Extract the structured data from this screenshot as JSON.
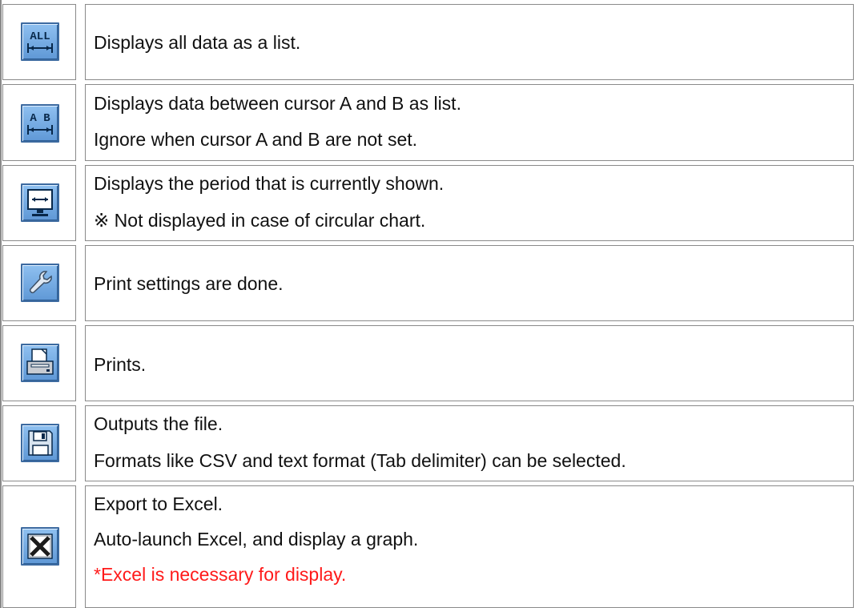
{
  "rows": [
    {
      "icon": "all-range-icon",
      "lines": [
        "Displays all data as a list."
      ]
    },
    {
      "icon": "ab-range-icon",
      "lines": [
        "Displays data between cursor A and B as list.",
        "Ignore when cursor A and B are not set."
      ]
    },
    {
      "icon": "monitor-period-icon",
      "lines": [
        "Displays the period that is currently shown.",
        "※ Not displayed in case of circular chart."
      ]
    },
    {
      "icon": "wrench-icon",
      "lines": [
        "Print settings are done."
      ]
    },
    {
      "icon": "printer-icon",
      "lines": [
        "Prints."
      ]
    },
    {
      "icon": "floppy-disk-icon",
      "lines": [
        "Outputs the file.",
        "Formats like CSV and text format (Tab delimiter) can be selected."
      ]
    },
    {
      "icon": "excel-icon",
      "lines": [
        "Export to Excel.",
        "Auto-launch Excel, and display a graph.",
        "*Excel is necessary for display."
      ]
    }
  ],
  "colors": {
    "warning_text": "#ff1a1a",
    "border": "#8a8a8a",
    "icon_fill": "#6fa8e0"
  }
}
